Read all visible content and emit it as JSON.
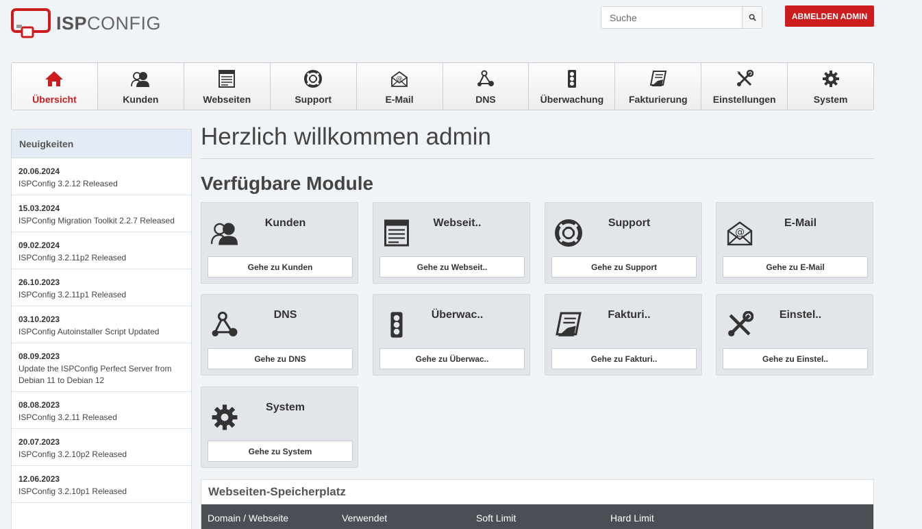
{
  "header": {
    "logo_bold": "ISP",
    "logo_light": "CONFIG",
    "search_placeholder": "Suche",
    "logout_label": "ABMELDEN ADMIN"
  },
  "nav": [
    {
      "label": "Übersicht",
      "icon": "home-icon",
      "active": true
    },
    {
      "label": "Kunden",
      "icon": "users-icon"
    },
    {
      "label": "Webseiten",
      "icon": "website-icon"
    },
    {
      "label": "Support",
      "icon": "lifebuoy-icon"
    },
    {
      "label": "E-Mail",
      "icon": "email-icon"
    },
    {
      "label": "DNS",
      "icon": "dns-icon"
    },
    {
      "label": "Überwachung",
      "icon": "traffic-light-icon"
    },
    {
      "label": "Fakturierung",
      "icon": "invoice-icon"
    },
    {
      "label": "Einstellungen",
      "icon": "tools-icon"
    },
    {
      "label": "System",
      "icon": "gear-icon"
    }
  ],
  "sidebar": {
    "title": "Neuigkeiten",
    "news": [
      {
        "date": "20.06.2024",
        "title": "ISPConfig 3.2.12 Released"
      },
      {
        "date": "15.03.2024",
        "title": "ISPConfig Migration Toolkit 2.2.7 Released"
      },
      {
        "date": "09.02.2024",
        "title": "ISPConfig 3.2.11p2 Released"
      },
      {
        "date": "26.10.2023",
        "title": "ISPConfig 3.2.11p1 Released"
      },
      {
        "date": "03.10.2023",
        "title": "ISPConfig Autoinstaller Script Updated"
      },
      {
        "date": "08.09.2023",
        "title": "Update the ISPConfig Perfect Server from Debian 11 to Debian 12"
      },
      {
        "date": "08.08.2023",
        "title": "ISPConfig 3.2.11 Released"
      },
      {
        "date": "20.07.2023",
        "title": "ISPConfig 3.2.10p2 Released"
      },
      {
        "date": "12.06.2023",
        "title": "ISPConfig 3.2.10p1 Released"
      }
    ]
  },
  "main": {
    "welcome": "Herzlich willkommen admin",
    "modules_title": "Verfügbare Module",
    "modules": [
      {
        "title": "Kunden",
        "button": "Gehe zu Kunden",
        "icon": "users-icon"
      },
      {
        "title": "Webseit..",
        "button": "Gehe zu Webseit..",
        "icon": "website-icon"
      },
      {
        "title": "Support",
        "button": "Gehe zu Support",
        "icon": "lifebuoy-icon"
      },
      {
        "title": "E-Mail",
        "button": "Gehe zu E-Mail",
        "icon": "email-icon"
      },
      {
        "title": "DNS",
        "button": "Gehe zu DNS",
        "icon": "dns-icon"
      },
      {
        "title": "Überwac..",
        "button": "Gehe zu Überwac..",
        "icon": "traffic-light-icon"
      },
      {
        "title": "Fakturi..",
        "button": "Gehe zu Fakturi..",
        "icon": "invoice-icon"
      },
      {
        "title": "Einstel..",
        "button": "Gehe zu Einstel..",
        "icon": "tools-icon"
      },
      {
        "title": "System",
        "button": "Gehe zu System",
        "icon": "gear-icon"
      }
    ],
    "storage": {
      "title": "Webseiten-Speicherplatz",
      "columns": [
        "Domain / Webseite",
        "Verwendet",
        "Soft Limit",
        "Hard Limit"
      ]
    }
  },
  "colors": {
    "accent": "#cc1c1e",
    "table_header": "#4a4f55",
    "sidebar_header": "#e3ebf4"
  }
}
